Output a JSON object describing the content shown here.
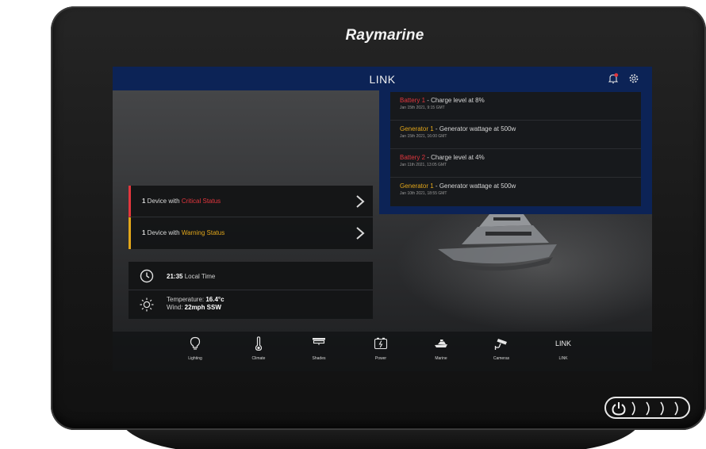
{
  "device": {
    "brand": "Raymarine"
  },
  "topbar": {
    "title": "LINK"
  },
  "notifications": [
    {
      "source": "Battery 1",
      "level": "critical",
      "message": " - Charge level at 8%",
      "date": "Jan 15th 2021, 9:15 GMT"
    },
    {
      "source": "Generator 1",
      "level": "warning",
      "message": " - Generator wattage at 500w",
      "date": "Jan 15th 2021, 16:00 GMT"
    },
    {
      "source": "Battery 2",
      "level": "critical",
      "message": " - Charge level at 4%",
      "date": "Jan 11th 2021, 13:05 GMT"
    },
    {
      "source": "Generator 1",
      "level": "warning",
      "message": " - Generator wattage at 500w",
      "date": "Jan 10th 2021, 18:55 GMT"
    }
  ],
  "status": {
    "critical": {
      "count": "1",
      "prefix": " Device with ",
      "label": "Critical Status"
    },
    "warning": {
      "count": "1",
      "prefix": " Device with ",
      "label": "Warning Status"
    }
  },
  "info": {
    "time": "21:35",
    "time_label": " Local Time",
    "temperature_label": "Temperature: ",
    "temperature": "16.4°c",
    "wind_label": "Wind: ",
    "wind": "22mph SSW"
  },
  "nav": {
    "items": [
      {
        "label": "Lighting",
        "icon": "bulb-icon"
      },
      {
        "label": "Climate",
        "icon": "thermometer-icon"
      },
      {
        "label": "Shades",
        "icon": "shades-icon"
      },
      {
        "label": "Power",
        "icon": "battery-icon"
      },
      {
        "label": "Marine",
        "icon": "boat-icon"
      },
      {
        "label": "Cameras",
        "icon": "camera-icon"
      },
      {
        "label": "LINK",
        "icon_text": "LINK"
      }
    ]
  },
  "colors": {
    "header": "#0c2356",
    "critical": "#e2363d",
    "warning": "#e2a61a"
  }
}
